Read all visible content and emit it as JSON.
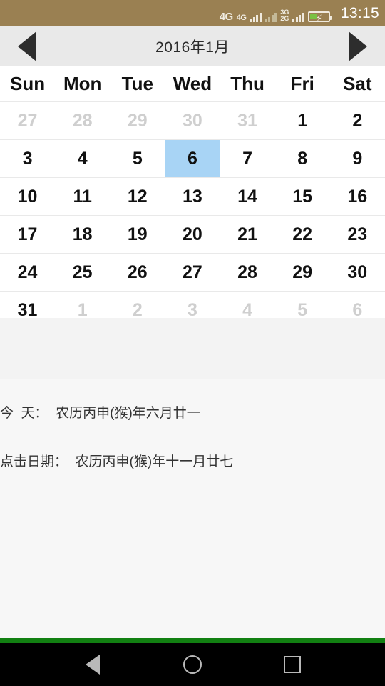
{
  "statusbar": {
    "net_primary": "4G",
    "net_secondary": "4G",
    "sim2_top": "3G",
    "sim2_bottom": "2G",
    "clock": "13:15",
    "battery_icon": "battery-charging-icon",
    "bg_color": "#9a8052"
  },
  "header": {
    "prev_icon": "left-triangle-icon",
    "next_icon": "right-triangle-icon",
    "title": "2016年1月"
  },
  "calendar": {
    "weekdays": [
      "Sun",
      "Mon",
      "Tue",
      "Wed",
      "Thu",
      "Fri",
      "Sat"
    ],
    "selected_day": "6",
    "selected_color": "#a8d4f5",
    "weeks": [
      [
        {
          "d": "27",
          "out": true
        },
        {
          "d": "28",
          "out": true
        },
        {
          "d": "29",
          "out": true
        },
        {
          "d": "30",
          "out": true
        },
        {
          "d": "31",
          "out": true
        },
        {
          "d": "1",
          "out": false
        },
        {
          "d": "2",
          "out": false
        }
      ],
      [
        {
          "d": "3",
          "out": false
        },
        {
          "d": "4",
          "out": false
        },
        {
          "d": "5",
          "out": false
        },
        {
          "d": "6",
          "out": false,
          "sel": true
        },
        {
          "d": "7",
          "out": false
        },
        {
          "d": "8",
          "out": false
        },
        {
          "d": "9",
          "out": false
        }
      ],
      [
        {
          "d": "10",
          "out": false
        },
        {
          "d": "11",
          "out": false
        },
        {
          "d": "12",
          "out": false
        },
        {
          "d": "13",
          "out": false
        },
        {
          "d": "14",
          "out": false
        },
        {
          "d": "15",
          "out": false
        },
        {
          "d": "16",
          "out": false
        }
      ],
      [
        {
          "d": "17",
          "out": false
        },
        {
          "d": "18",
          "out": false
        },
        {
          "d": "19",
          "out": false
        },
        {
          "d": "20",
          "out": false
        },
        {
          "d": "21",
          "out": false
        },
        {
          "d": "22",
          "out": false
        },
        {
          "d": "23",
          "out": false
        }
      ],
      [
        {
          "d": "24",
          "out": false
        },
        {
          "d": "25",
          "out": false
        },
        {
          "d": "26",
          "out": false
        },
        {
          "d": "27",
          "out": false
        },
        {
          "d": "28",
          "out": false
        },
        {
          "d": "29",
          "out": false
        },
        {
          "d": "30",
          "out": false
        }
      ],
      [
        {
          "d": "31",
          "out": false
        },
        {
          "d": "1",
          "out": true
        },
        {
          "d": "2",
          "out": true
        },
        {
          "d": "3",
          "out": true
        },
        {
          "d": "4",
          "out": true
        },
        {
          "d": "5",
          "out": true
        },
        {
          "d": "6",
          "out": true
        }
      ]
    ]
  },
  "info": {
    "today_line": "今  天：  农历丙申(猴)年六月廿一",
    "clicked_line": "点击日期：  农历丙申(猴)年十一月廿七"
  },
  "navbar": {
    "back_icon": "back-triangle-icon",
    "home_icon": "home-circle-icon",
    "recents_icon": "recents-square-icon",
    "accent_bar_color": "#128012"
  }
}
